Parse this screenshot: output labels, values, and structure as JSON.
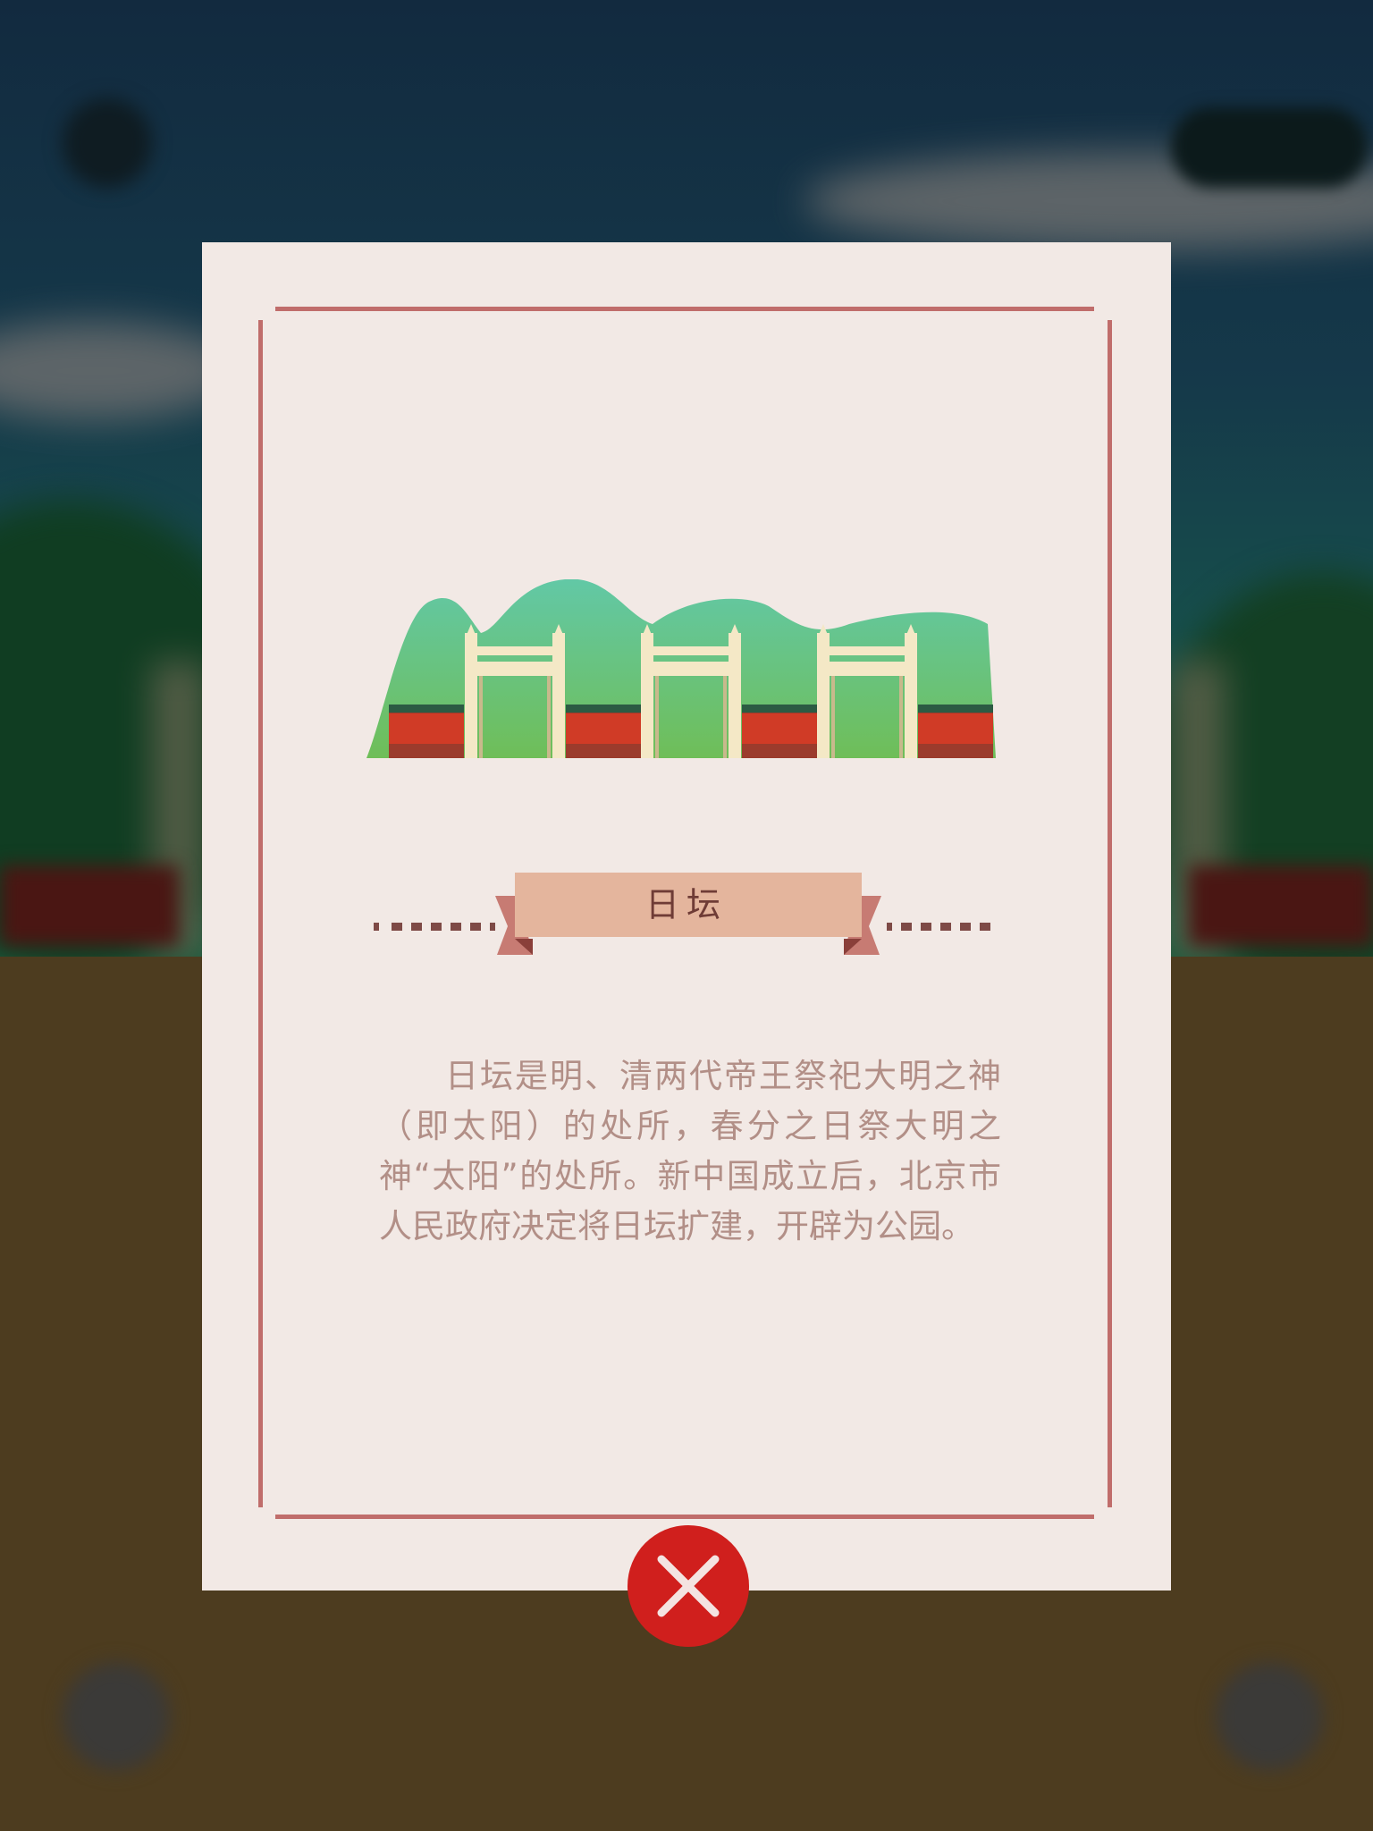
{
  "card": {
    "title": "日坛",
    "description": "日坛是明、清两代帝王祭祀大明之神（即太阳）的处所，春分之日祭大明之神“太阳”的处所。新中国成立后，北京市人民政府决定将日坛扩建，开辟为公园。"
  },
  "icons": {
    "close": "close-icon",
    "landmark": "temple-of-the-sun-gates-illustration"
  },
  "colors": {
    "card_background": "#f2e9e5",
    "frame": "#c06d6b",
    "banner": "#e4b59d",
    "title_text": "#6f3c36",
    "body_text": "#b28f87",
    "close_button": "#d01f1d"
  }
}
